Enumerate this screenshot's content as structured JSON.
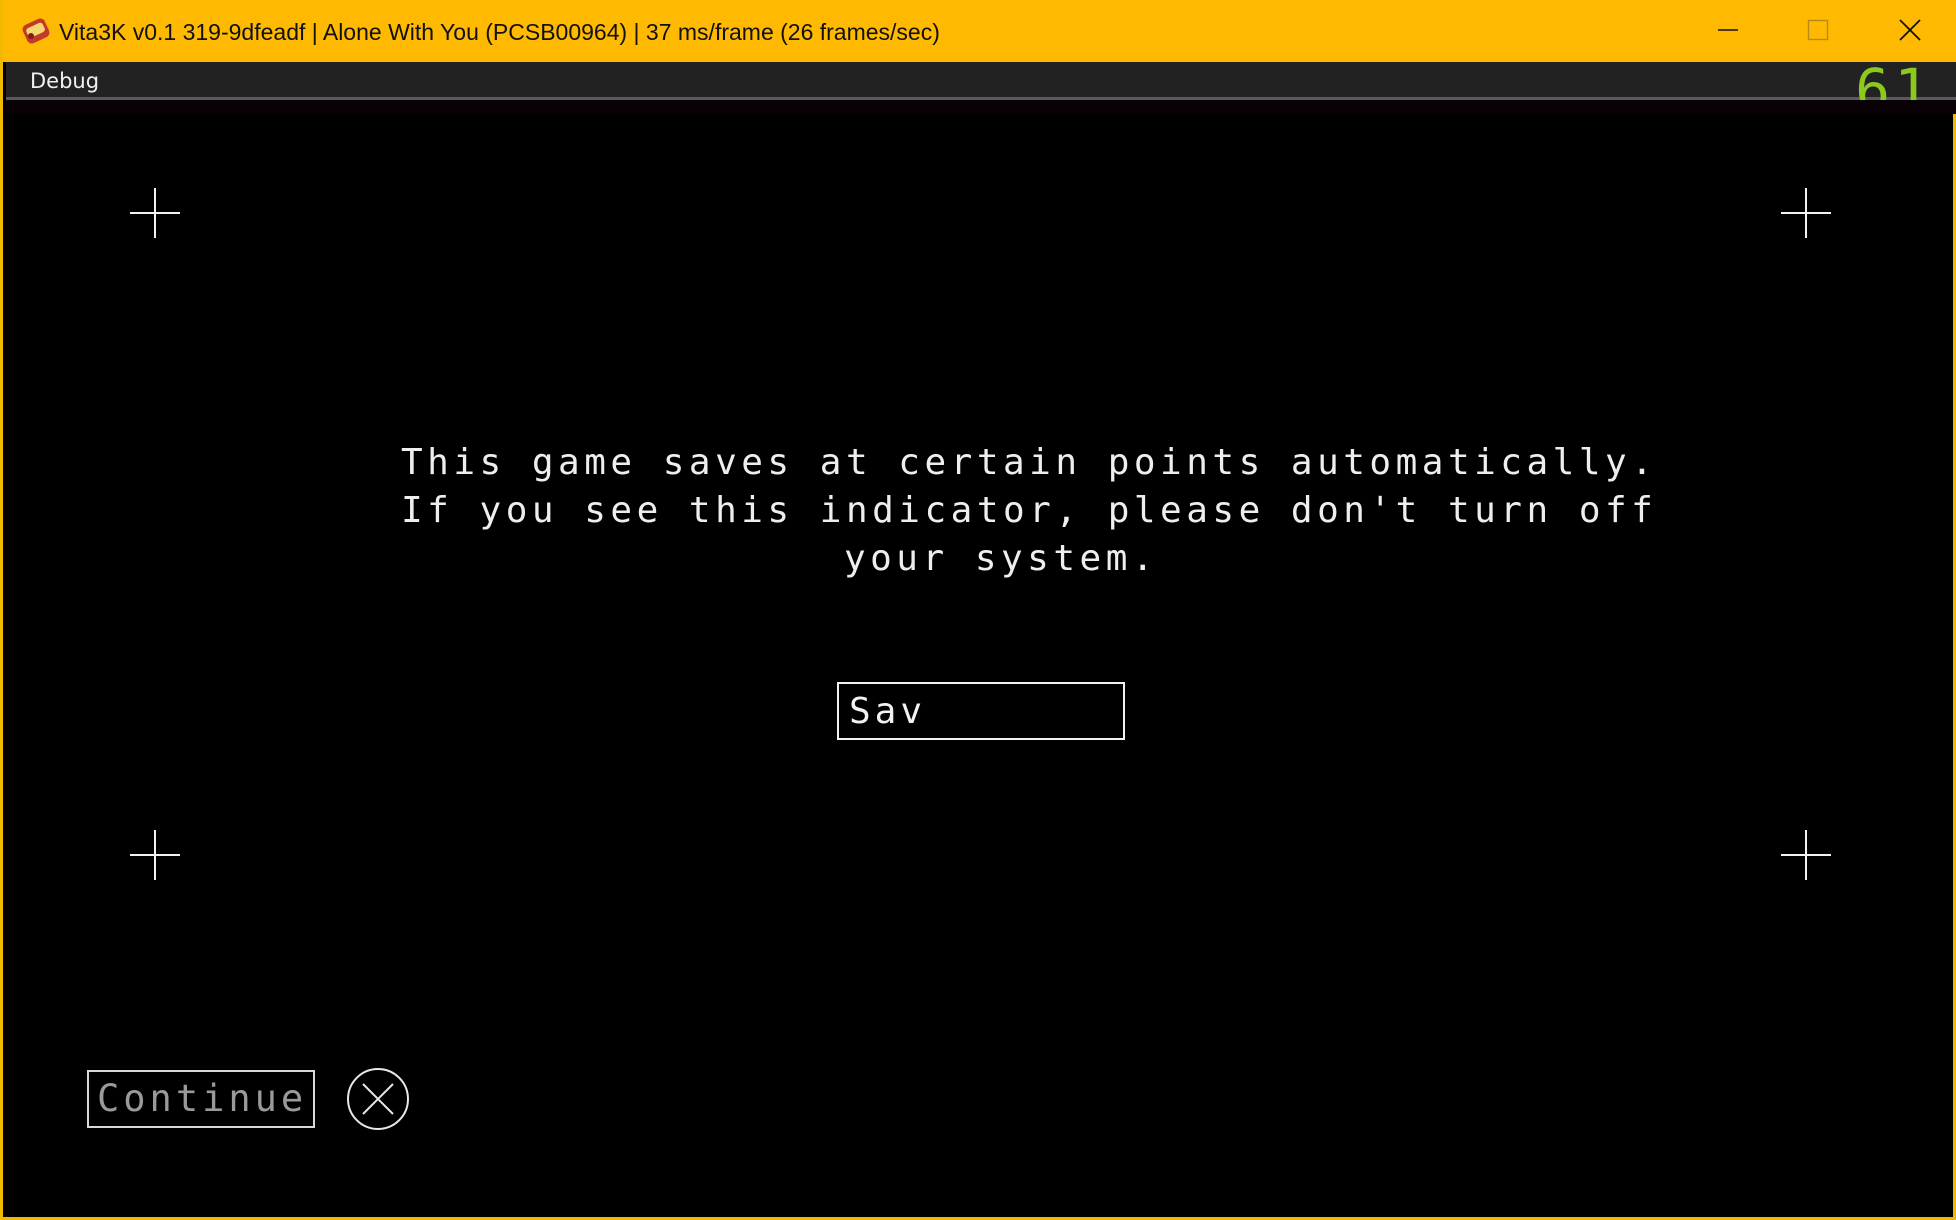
{
  "window": {
    "title": "Vita3K v0.1 319-9dfeadf | Alone With You (PCSB00964) | 37 ms/frame (26 frames/sec)",
    "accent_color": "#ffb900",
    "app_icon": "vita3k-logo-icon",
    "controls": {
      "minimize_icon": "minimize-icon",
      "maximize_icon": "maximize-icon",
      "close_icon": "close-icon"
    }
  },
  "menubar": {
    "items": [
      {
        "label": "Debug"
      }
    ],
    "fps_counter": "61",
    "fps_color": "#8cc81e"
  },
  "game": {
    "message_lines": [
      "This game saves at certain points automatically.",
      "If you see this indicator, please don't turn off",
      "your system."
    ],
    "save_indicator_text": "Sav",
    "continue_label": "Continue",
    "confirm_icon": "cross-button-icon",
    "corner_marker_icon": "crosshair-icon"
  }
}
